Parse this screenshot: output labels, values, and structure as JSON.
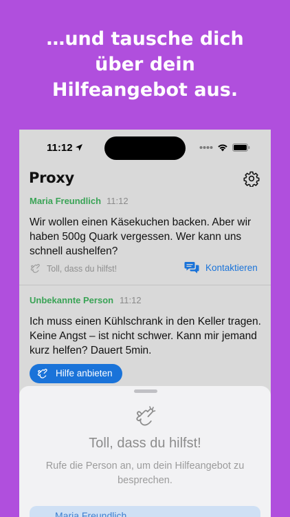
{
  "headline": {
    "line1": "…und tausche dich",
    "line2": "über dein",
    "line3": "Hilfeangebot aus."
  },
  "statusbar": {
    "time": "11:12"
  },
  "app": {
    "title": "Proxy"
  },
  "posts": [
    {
      "author": "Maria Freundlich",
      "time": "11:12",
      "text": "Wir wollen einen Käsekuchen backen. Aber wir haben 500g Quark vergessen. Wer kann uns schnell aushelfen?",
      "thanks_label": "Toll, dass du hilfst!",
      "contact_label": "Kontaktieren"
    },
    {
      "author": "Unbekannte Person",
      "time": "11:12",
      "text": "Ich muss einen Kühlschrank in den Keller tragen. Keine Angst – ist nicht schwer. Kann mir jemand kurz helfen? Dauert 5min.",
      "help_label": "Hilfe anbieten"
    }
  ],
  "sheet": {
    "title": "Toll, dass du hilfst!",
    "message": "Rufe die Person an, um dein Hilfeangebot zu besprechen.",
    "contact_name": "Maria Freundlich"
  },
  "colors": {
    "background": "#b04fdd",
    "author_green": "#3aa356",
    "accent_blue": "#1a73d9"
  },
  "icons": [
    "location-arrow-icon",
    "signal-icon",
    "wifi-icon",
    "battery-icon",
    "gear-icon",
    "clapping-hands-icon",
    "chat-bubbles-icon"
  ]
}
